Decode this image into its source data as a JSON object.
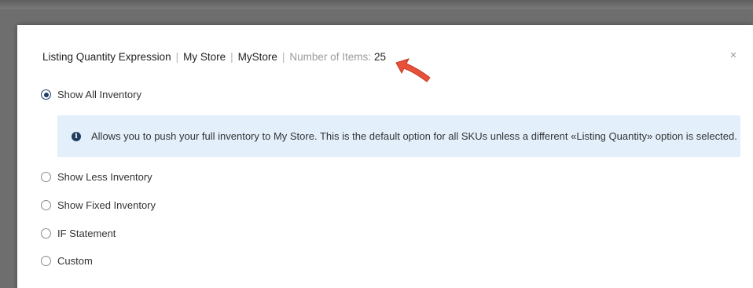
{
  "dialog": {
    "header": {
      "title": "Listing Quantity Expression",
      "store_primary": "My Store",
      "store_secondary": "MyStore",
      "items_label": "Number of Items:",
      "items_count": "25"
    },
    "close_label": "×",
    "options": [
      {
        "label": "Show All Inventory",
        "selected": true
      },
      {
        "label": "Show Less Inventory",
        "selected": false
      },
      {
        "label": "Show Fixed Inventory",
        "selected": false
      },
      {
        "label": "IF Statement",
        "selected": false
      },
      {
        "label": "Custom",
        "selected": false
      }
    ],
    "info": {
      "icon": "info-icon",
      "text": "Allows you to push your full inventory to My Store. This is the default option for all SKUs unless a different «Listing Quantity» option is selected."
    }
  },
  "annotation": {
    "icon": "red-arrow-icon",
    "color": "#e8503a"
  },
  "colors": {
    "backdrop": "#6e6e6e",
    "info_background": "#e3f0fb",
    "radio_selected": "#1f3f66"
  }
}
